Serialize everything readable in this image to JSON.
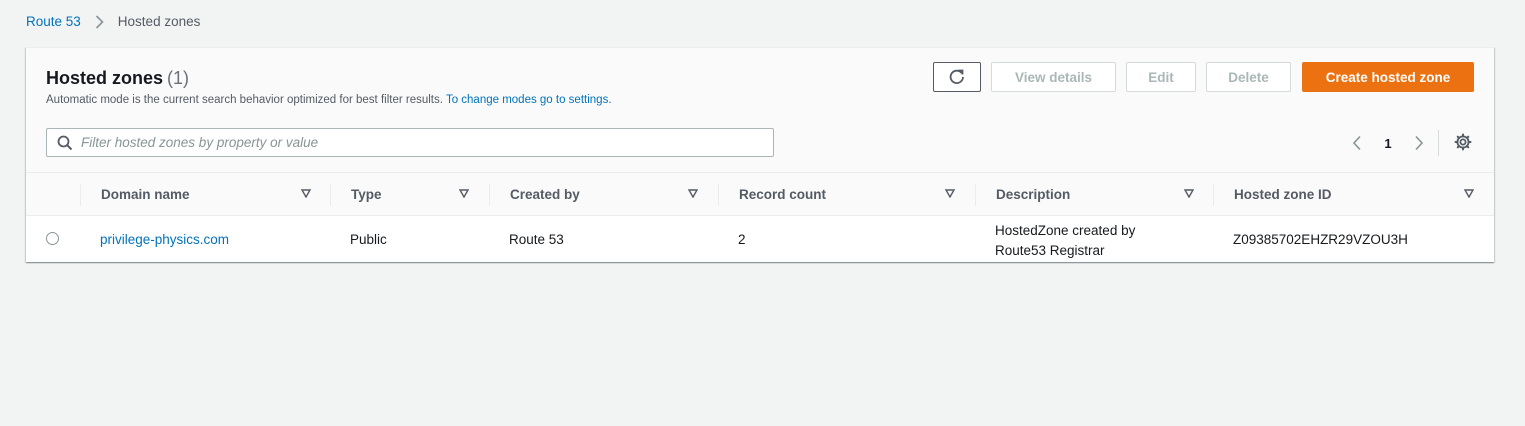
{
  "breadcrumb": {
    "root": "Route 53",
    "current": "Hosted zones"
  },
  "panel": {
    "title": "Hosted zones",
    "count": "(1)",
    "subtitle": "Automatic mode is the current search behavior optimized for best filter results.",
    "subtitle_link": "To change modes go to settings."
  },
  "actions": {
    "refresh_icon": "refresh-icon",
    "view_details": "View details",
    "edit": "Edit",
    "delete": "Delete",
    "create": "Create hosted zone"
  },
  "search": {
    "placeholder": "Filter hosted zones by property or value",
    "value": ""
  },
  "pagination": {
    "current_page": "1"
  },
  "table": {
    "columns": [
      "Domain name",
      "Type",
      "Created by",
      "Record count",
      "Description",
      "Hosted zone ID"
    ],
    "rows": [
      {
        "domain": "privilege-physics.com",
        "type": "Public",
        "created_by": "Route 53",
        "record_count": "2",
        "description_line1": "HostedZone created by",
        "description_line2": "Route53 Registrar",
        "zone_id": "Z09385702EHZR29VZOU3H"
      }
    ]
  },
  "colors": {
    "accent": "#ec7211",
    "link": "#0073bb",
    "background": "#f2f3f3"
  }
}
